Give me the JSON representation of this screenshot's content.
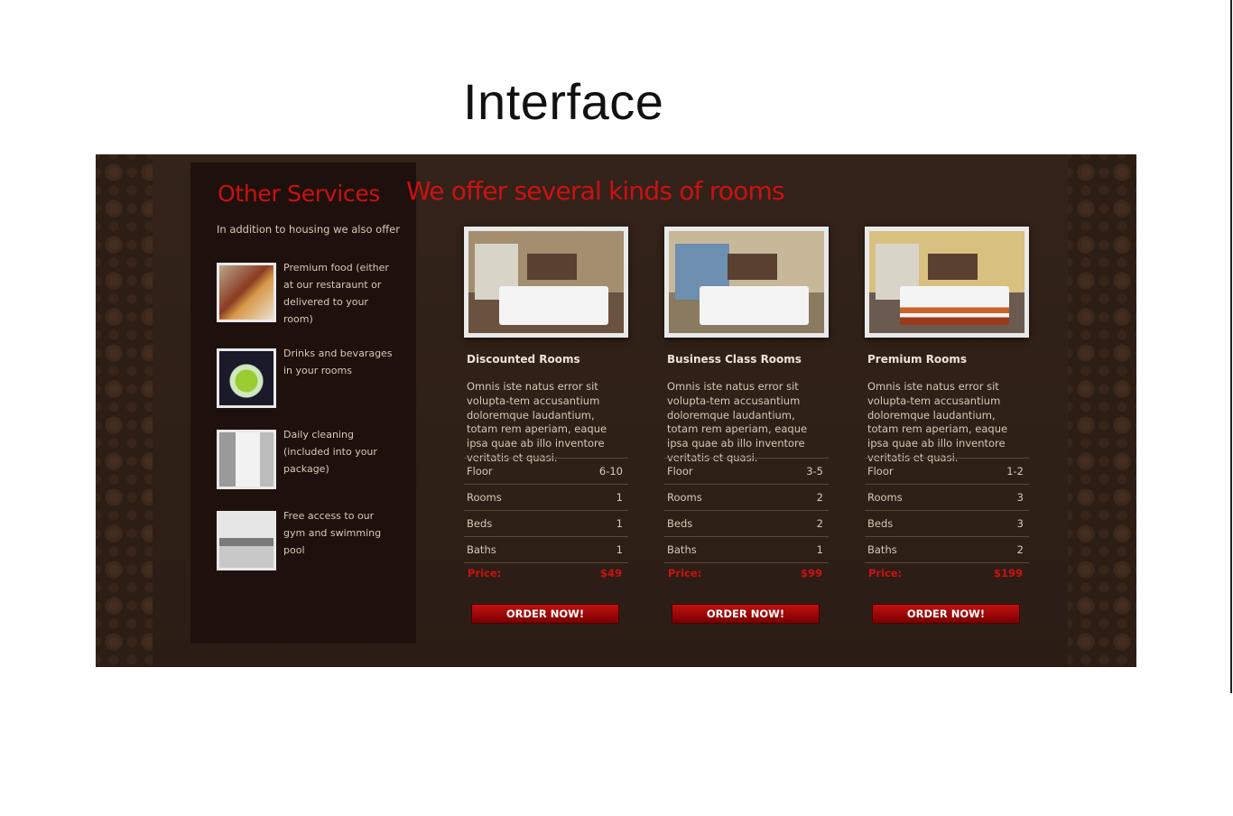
{
  "slide": {
    "title": "Interface"
  },
  "sidebar": {
    "title": "Other Services",
    "intro": "In addition to housing we also offer",
    "services": [
      {
        "icon": "food-image",
        "text": "Premium food (either at our restaraunt or delivered to your room)"
      },
      {
        "icon": "drink-image",
        "text": "Drinks and bevarages in your rooms"
      },
      {
        "icon": "towel-image",
        "text": "Daily cleaning (included into your package)"
      },
      {
        "icon": "gym-image",
        "text": "Free access to our gym and swimming pool"
      }
    ]
  },
  "main": {
    "title": "We offer several kinds of rooms",
    "rooms": [
      {
        "name": "Discounted Rooms",
        "description": "Omnis iste natus error sit volupta-tem accusantium doloremque laudantium, totam rem aperiam, eaque ipsa quae ab illo inventore veritatis et quasi.",
        "specs": [
          {
            "label": "Floor",
            "value": "6-10"
          },
          {
            "label": "Rooms",
            "value": "1"
          },
          {
            "label": "Beds",
            "value": "1"
          },
          {
            "label": "Baths",
            "value": "1"
          }
        ],
        "price_label": "Price:",
        "price": "$49",
        "button": "ORDER NOW!"
      },
      {
        "name": "Business Class Rooms",
        "description": "Omnis iste natus error sit volupta-tem accusantium doloremque laudantium, totam rem aperiam, eaque ipsa quae ab illo inventore veritatis et quasi.",
        "specs": [
          {
            "label": "Floor",
            "value": "3-5"
          },
          {
            "label": "Rooms",
            "value": "2"
          },
          {
            "label": "Beds",
            "value": "2"
          },
          {
            "label": "Baths",
            "value": "1"
          }
        ],
        "price_label": "Price:",
        "price": "$99",
        "button": "ORDER NOW!"
      },
      {
        "name": "Premium Rooms",
        "description": "Omnis iste natus error sit volupta-tem accusantium doloremque laudantium, totam rem aperiam, eaque ipsa quae ab illo inventore veritatis et quasi.",
        "specs": [
          {
            "label": "Floor",
            "value": "1-2"
          },
          {
            "label": "Rooms",
            "value": "3"
          },
          {
            "label": "Beds",
            "value": "3"
          },
          {
            "label": "Baths",
            "value": "2"
          }
        ],
        "price_label": "Price:",
        "price": "$199",
        "button": "ORDER NOW!"
      }
    ]
  },
  "colors": {
    "accent_red": "#cc1111",
    "background_brown": "#2a1c14",
    "sidebar_dark": "#1e110d",
    "text_light": "#d8c8b4"
  }
}
